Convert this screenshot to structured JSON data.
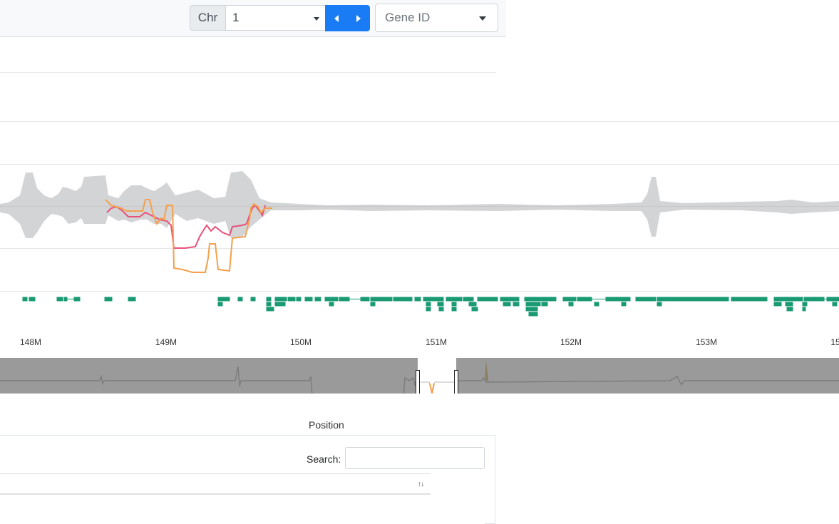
{
  "toolbar": {
    "chr_label": "Chr",
    "chr_value": "1",
    "prev_label": "◀",
    "next_label": "▶",
    "gene_placeholder": "Gene ID",
    "accent": "#1a7cf5"
  },
  "genome_view": {
    "x_ticks": [
      "148M",
      "149M",
      "150M",
      "151M",
      "152M",
      "153M",
      "15"
    ],
    "series_colors": {
      "band": "#d2d4d6",
      "line_a": "#e8527a",
      "line_b": "#f4a04c",
      "genes": "#1a9a73",
      "overview": "#9a9a9a"
    }
  },
  "table": {
    "column_label": "Position",
    "search_label": "Search:",
    "search_value": "",
    "sort_icon": "↑↓"
  }
}
